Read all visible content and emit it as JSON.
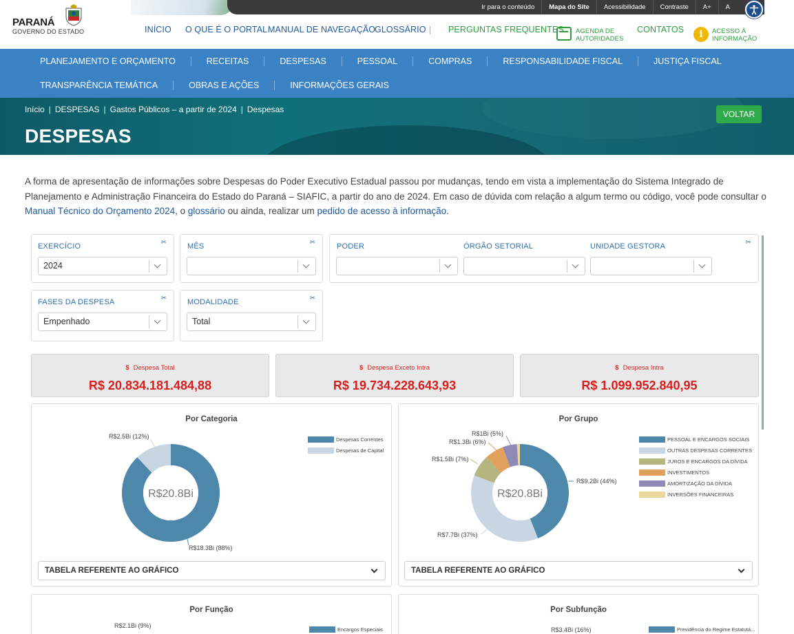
{
  "header": {
    "logo_brand": "PARANÁ",
    "logo_sub": "GOVERNO DO ESTADO",
    "utility_links": [
      "Ir para o conteúdo",
      "Mapa do Site",
      "Acessibilidade",
      "Contraste",
      "A+",
      "A"
    ],
    "main_nav": [
      "INÍCIO",
      "O QUE É O PORTAL",
      "MANUAL DE NAVEGAÇÃO",
      "GLOSSÁRIO"
    ],
    "faq": "PERGUNTAS FREQUENTES",
    "agenda_line1": "AGENDA DE",
    "agenda_line2": "AUTORIDADES",
    "contatos": "CONTATOS",
    "acesso_line1": "ACESSO À",
    "acesso_line2": "INFORMAÇÃO"
  },
  "menu": {
    "row1": [
      "PLANEJAMENTO E ORÇAMENTO",
      "RECEITAS",
      "DESPESAS",
      "PESSOAL",
      "COMPRAS",
      "RESPONSABILIDADE FISCAL",
      "JUSTIÇA FISCAL"
    ],
    "row2": [
      "TRANSPARÊNCIA TEMÁTICA",
      "OBRAS E AÇÕES",
      "INFORMAÇÕES GERAIS"
    ]
  },
  "breadcrumb": [
    "Início",
    "DESPESAS",
    "Gastos Públicos – a partir de 2024",
    "Despesas"
  ],
  "page_title": "DESPESAS",
  "voltar": "VOLTAR",
  "intro": {
    "text1": "A forma de apresentação de informações sobre Despesas do Poder Executivo Estadual passou por mudanças, tendo em vista a implementação do Sistema Integrado de Planejamento e Administração Financeira do Estado do Paraná – SIAFIC, a partir do ano de 2024. Em caso de dúvida com relação a algum termo ou código, você pode consultar o ",
    "link1": "Manual Técnico do Orçamento 2024",
    "text2": ", o ",
    "link2": "glossário",
    "text3": " ou ainda, realizar um ",
    "link3": "pedido de acesso à informação",
    "text4": "."
  },
  "filters": {
    "exercicio": {
      "label": "EXERCÍCIO",
      "value": "2024"
    },
    "mes": {
      "label": "MÊS",
      "value": ""
    },
    "poder": {
      "label": "PODER",
      "value": ""
    },
    "orgao": {
      "label": "ÓRGÃO SETORIAL",
      "value": ""
    },
    "unidade": {
      "label": "UNIDADE GESTORA",
      "value": ""
    },
    "fases": {
      "label": "FASES DA DESPESA",
      "value": "Empenhado"
    },
    "modalidade": {
      "label": "MODALIDADE",
      "value": "Total"
    }
  },
  "kpis": [
    {
      "label": "Despesa Total",
      "value": "R$ 20.834.181.484,88"
    },
    {
      "label": "Despesa Exceto Intra",
      "value": "R$ 19.734.228.643,93"
    },
    {
      "label": "Despesa Intra",
      "value": "R$ 1.099.952.840,95"
    }
  ],
  "accordion_label": "TABELA REFERENTE AO GRÁFICO",
  "chart_data": [
    {
      "type": "pie",
      "donut": true,
      "title": "Por Categoria",
      "center_label": "R$20.8Bi",
      "categories": [
        "Despesas Correntes",
        "Despesas de Capital"
      ],
      "values": [
        18.3,
        2.5
      ],
      "data_labels": [
        "R$18.3Bi (88%)",
        "R$2.5Bi (12%)"
      ],
      "colors": [
        "#4d87aa",
        "#c8d6e3"
      ],
      "legend": "top-right"
    },
    {
      "type": "pie",
      "donut": true,
      "title": "Por Grupo",
      "center_label": "R$20.8Bi",
      "categories": [
        "PESSOAL E ENCARGOS SOCIAIS",
        "OUTRAS DESPESAS CORRENTES",
        "JUROS E ENCARGOS DA DÍVIDA",
        "INVESTIMENTOS",
        "AMORTIZAÇÃO DA DÍVIDA",
        "INVERSÕES FINANCEIRAS"
      ],
      "values": [
        9.2,
        7.7,
        1.5,
        1.3,
        1.0,
        0.2
      ],
      "data_labels": [
        "R$9.2Bi (44%)",
        "R$7.7Bi (37%)",
        "R$1.5Bi (7%)",
        "R$1.3Bi (6%)",
        "R$1Bi (5%)",
        ""
      ],
      "colors": [
        "#4d87aa",
        "#c8d6e3",
        "#b5b67f",
        "#e1a15c",
        "#8f89b8",
        "#ecd79a"
      ],
      "legend": "top-right"
    },
    {
      "type": "pie",
      "title": "Por Função",
      "categories": [
        "Encargos Especiais"
      ],
      "data_labels": [
        "R$2.1Bi (9%)"
      ],
      "colors": [
        "#4d87aa"
      ]
    },
    {
      "type": "pie",
      "title": "Por Subfunção",
      "categories": [
        "Previdência do Regime Estatutá..."
      ],
      "data_labels": [
        "R$3.4Bi (16%)"
      ],
      "colors": [
        "#4d87aa"
      ]
    }
  ]
}
